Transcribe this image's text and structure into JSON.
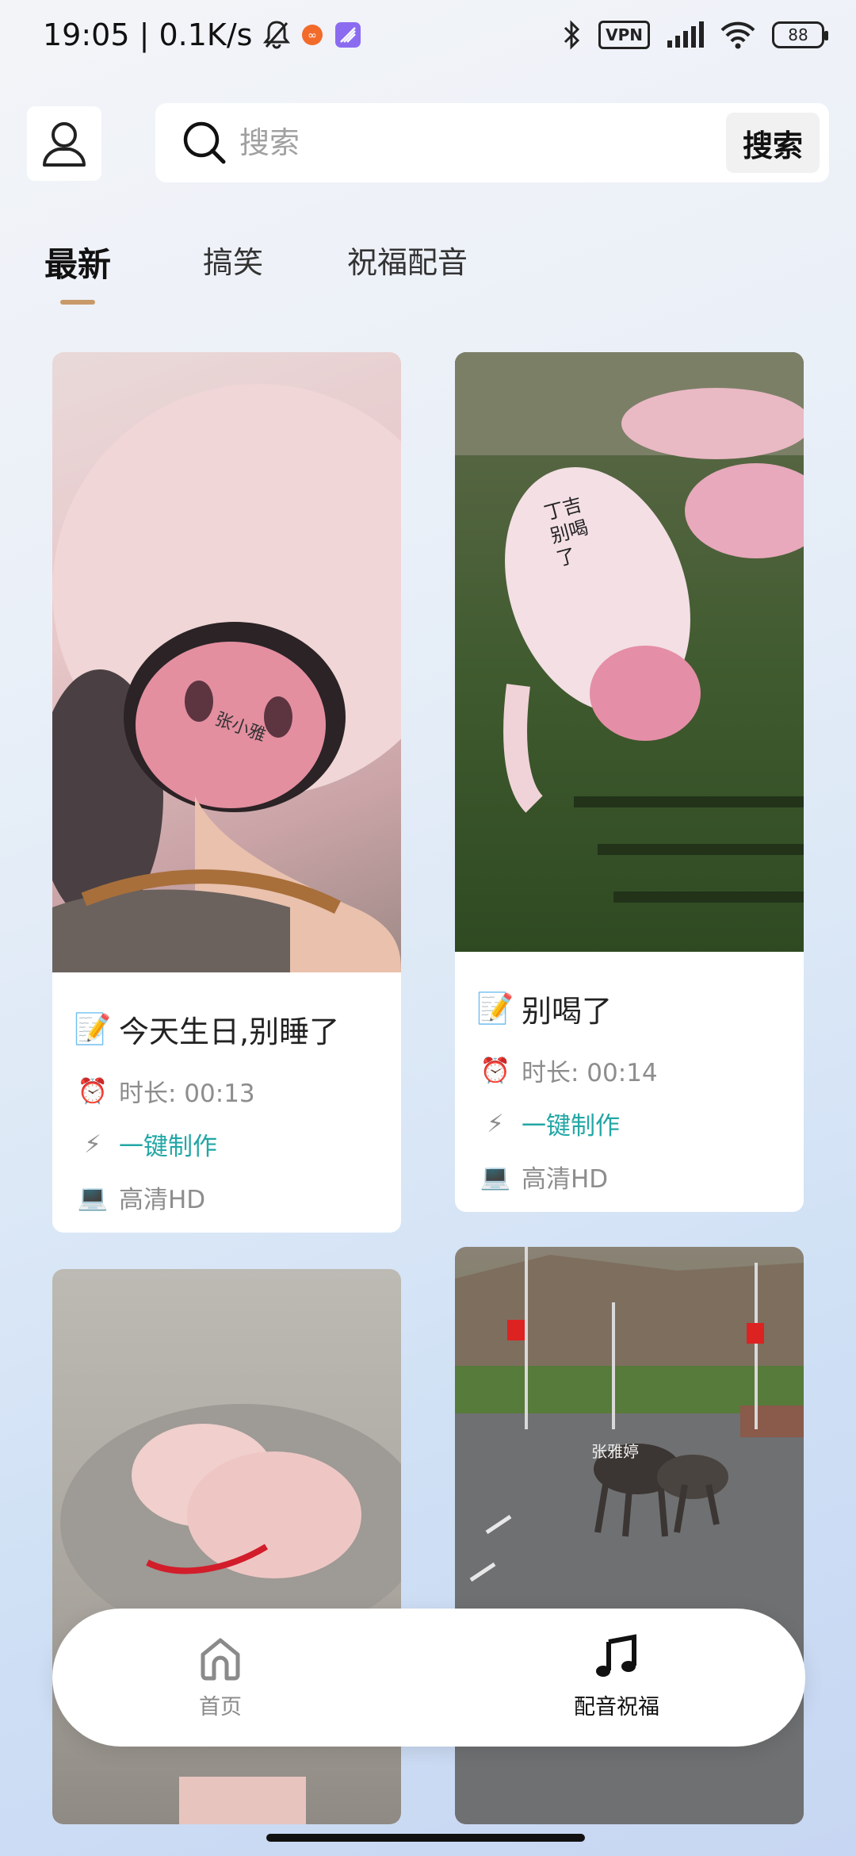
{
  "status_bar": {
    "time_speed": "19:05 | 0.1K/s",
    "vpn": "VPN",
    "battery": "88",
    "icons": [
      "mute-bell-icon",
      "app-notif-icon",
      "gallery-icon",
      "bluetooth-icon",
      "vpn-icon",
      "signal-icon",
      "wifi-icon",
      "battery-icon"
    ]
  },
  "header": {
    "search_placeholder": "搜索",
    "search_button": "搜索"
  },
  "tabs": [
    {
      "label": "最新",
      "active": true
    },
    {
      "label": "搞笑",
      "active": false
    },
    {
      "label": "祝福配音",
      "active": false
    }
  ],
  "cards": [
    {
      "title_emoji": "📝",
      "title": "今天生日,别睡了",
      "duration_emoji": "⏰",
      "duration": "时长: 00:13",
      "make_emoji": "⚡",
      "make": "一键制作",
      "quality_emoji": "💻",
      "quality": "高清HD",
      "thumb_text": "张小雅"
    },
    {
      "title_emoji": "📝",
      "title": "别喝了",
      "duration_emoji": "⏰",
      "duration": "时长: 00:14",
      "make_emoji": "⚡",
      "make": "一键制作",
      "quality_emoji": "💻",
      "quality": "高清HD",
      "thumb_text": "丁吉别喝了"
    },
    {
      "thumb_text": ""
    },
    {
      "thumb_text": "张雅婷"
    }
  ],
  "bottom_nav": [
    {
      "label": "首页",
      "icon": "home-icon",
      "active": false
    },
    {
      "label": "配音祝福",
      "icon": "music-note-icon",
      "active": true
    }
  ]
}
